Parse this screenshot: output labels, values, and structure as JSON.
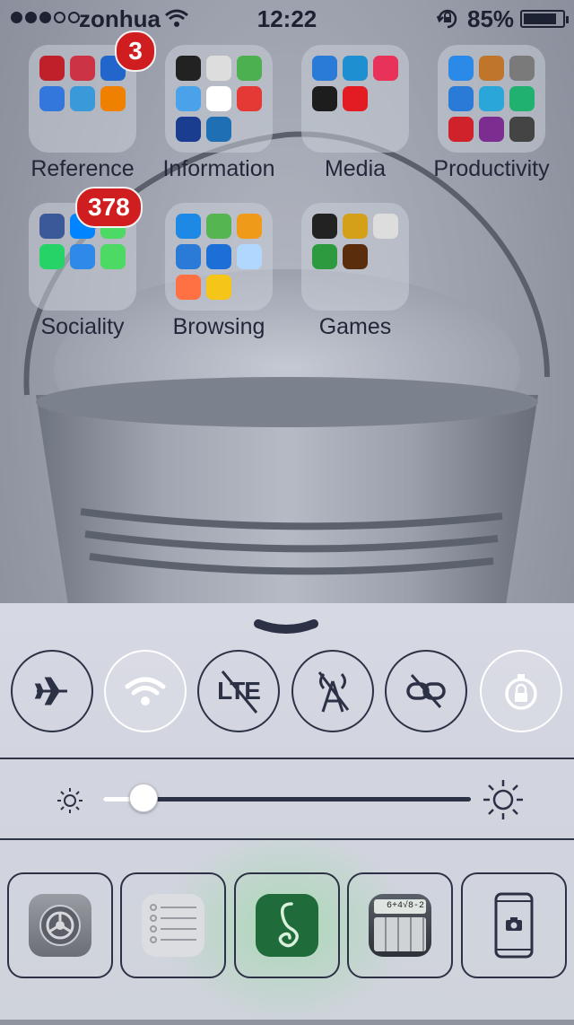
{
  "status_bar": {
    "signal_dots_filled": 3,
    "signal_dots_total": 5,
    "carrier": "zonhua",
    "time": "12:22",
    "battery_percent_text": "85%",
    "battery_level": 0.85
  },
  "folders": [
    {
      "label": "Reference",
      "badge": "3"
    },
    {
      "label": "Information",
      "badge": ""
    },
    {
      "label": "Media",
      "badge": ""
    },
    {
      "label": "Productivity",
      "badge": ""
    },
    {
      "label": "Sociality",
      "badge": "378"
    },
    {
      "label": "Browsing",
      "badge": ""
    },
    {
      "label": "Games",
      "badge": ""
    }
  ],
  "folder_icon_colors": [
    [
      "#c0202a",
      "#cc3344",
      "#2266cc",
      "#3377dd",
      "#3a9ad9",
      "#f08000"
    ],
    [
      "#222222",
      "#dddddd",
      "#4caf50",
      "#4aa3ea",
      "#ffffff",
      "#e53935",
      "#1b3d8f",
      "#1f6fb5"
    ],
    [
      "#2a7bd8",
      "#1e8fd0",
      "#e8325a",
      "#1d1d1d",
      "#e31b23"
    ],
    [
      "#2b89e8",
      "#c0762a",
      "#7a7a7a",
      "#2a7bd8",
      "#2aa6d8",
      "#20b070",
      "#d0222a",
      "#7b2e8f",
      "#444444"
    ],
    [
      "#3b5998",
      "#0084ff",
      "#4cd964",
      "#25d366",
      "#2e89e8",
      "#4cd964"
    ],
    [
      "#1e88e5",
      "#55b550",
      "#f09a1a",
      "#2a7bd8",
      "#1d6fd8",
      "#b0d8ff",
      "#ff7043",
      "#f5c518"
    ],
    [
      "#222222",
      "#d4a017",
      "#dddddd",
      "#2e9a3f",
      "#5a2d0c"
    ]
  ],
  "control_center": {
    "toggles": [
      {
        "name": "airplane-mode",
        "active": false
      },
      {
        "name": "wifi",
        "active": true
      },
      {
        "name": "lte",
        "active": false,
        "text": "LTE"
      },
      {
        "name": "personal-hotspot",
        "active": false
      },
      {
        "name": "link",
        "active": false
      },
      {
        "name": "rotation-lock",
        "active": true
      }
    ],
    "brightness": 0.11,
    "shortcuts": [
      {
        "name": "settings",
        "color": "#8c8e96"
      },
      {
        "name": "notes",
        "color": "#d8d8dc"
      },
      {
        "name": "music",
        "color": "#1f6b3a"
      },
      {
        "name": "calculator",
        "color": "#3a3f46",
        "text": "6+4√8-2"
      },
      {
        "name": "camera",
        "color": "#ffffff"
      }
    ]
  },
  "colors": {
    "accent_dark": "#2c3145",
    "badge_red": "#d01d20"
  }
}
